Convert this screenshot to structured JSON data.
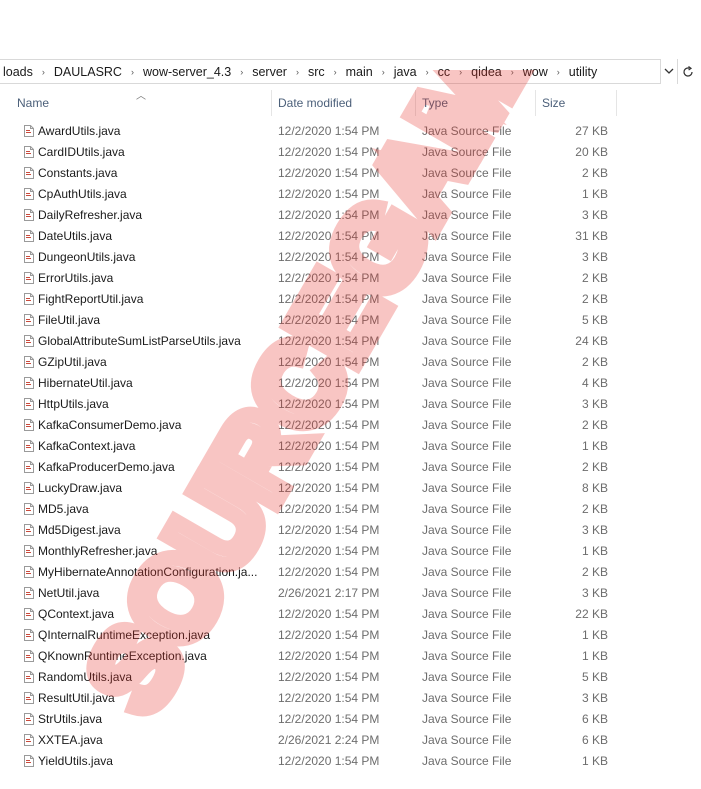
{
  "address_bar": {
    "crumbs": [
      "loads",
      "DAULASRC",
      "wow-server_4.3",
      "server",
      "src",
      "main",
      "java",
      "cc",
      "qidea",
      "wow",
      "utility"
    ]
  },
  "columns": {
    "name": "Name",
    "date": "Date modified",
    "type": "Type",
    "size": "Size"
  },
  "files": [
    {
      "name": "AwardUtils.java",
      "date": "12/2/2020 1:54 PM",
      "type": "Java Source File",
      "size": "27 KB"
    },
    {
      "name": "CardIDUtils.java",
      "date": "12/2/2020 1:54 PM",
      "type": "Java Source File",
      "size": "20 KB"
    },
    {
      "name": "Constants.java",
      "date": "12/2/2020 1:54 PM",
      "type": "Java Source File",
      "size": "2 KB"
    },
    {
      "name": "CpAuthUtils.java",
      "date": "12/2/2020 1:54 PM",
      "type": "Java Source File",
      "size": "1 KB"
    },
    {
      "name": "DailyRefresher.java",
      "date": "12/2/2020 1:54 PM",
      "type": "Java Source File",
      "size": "3 KB"
    },
    {
      "name": "DateUtils.java",
      "date": "12/2/2020 1:54 PM",
      "type": "Java Source File",
      "size": "31 KB"
    },
    {
      "name": "DungeonUtils.java",
      "date": "12/2/2020 1:54 PM",
      "type": "Java Source File",
      "size": "3 KB"
    },
    {
      "name": "ErrorUtils.java",
      "date": "12/2/2020 1:54 PM",
      "type": "Java Source File",
      "size": "2 KB"
    },
    {
      "name": "FightReportUtil.java",
      "date": "12/2/2020 1:54 PM",
      "type": "Java Source File",
      "size": "2 KB"
    },
    {
      "name": "FileUtil.java",
      "date": "12/2/2020 1:54 PM",
      "type": "Java Source File",
      "size": "5 KB"
    },
    {
      "name": "GlobalAttributeSumListParseUtils.java",
      "date": "12/2/2020 1:54 PM",
      "type": "Java Source File",
      "size": "24 KB"
    },
    {
      "name": "GZipUtil.java",
      "date": "12/2/2020 1:54 PM",
      "type": "Java Source File",
      "size": "2 KB"
    },
    {
      "name": "HibernateUtil.java",
      "date": "12/2/2020 1:54 PM",
      "type": "Java Source File",
      "size": "4 KB"
    },
    {
      "name": "HttpUtils.java",
      "date": "12/2/2020 1:54 PM",
      "type": "Java Source File",
      "size": "3 KB"
    },
    {
      "name": "KafkaConsumerDemo.java",
      "date": "12/2/2020 1:54 PM",
      "type": "Java Source File",
      "size": "2 KB"
    },
    {
      "name": "KafkaContext.java",
      "date": "12/2/2020 1:54 PM",
      "type": "Java Source File",
      "size": "1 KB"
    },
    {
      "name": "KafkaProducerDemo.java",
      "date": "12/2/2020 1:54 PM",
      "type": "Java Source File",
      "size": "2 KB"
    },
    {
      "name": "LuckyDraw.java",
      "date": "12/2/2020 1:54 PM",
      "type": "Java Source File",
      "size": "8 KB"
    },
    {
      "name": "MD5.java",
      "date": "12/2/2020 1:54 PM",
      "type": "Java Source File",
      "size": "2 KB"
    },
    {
      "name": "Md5Digest.java",
      "date": "12/2/2020 1:54 PM",
      "type": "Java Source File",
      "size": "3 KB"
    },
    {
      "name": "MonthlyRefresher.java",
      "date": "12/2/2020 1:54 PM",
      "type": "Java Source File",
      "size": "1 KB"
    },
    {
      "name": "MyHibernateAnnotationConfiguration.ja...",
      "date": "12/2/2020 1:54 PM",
      "type": "Java Source File",
      "size": "2 KB"
    },
    {
      "name": "NetUtil.java",
      "date": "2/26/2021 2:17 PM",
      "type": "Java Source File",
      "size": "3 KB"
    },
    {
      "name": "QContext.java",
      "date": "12/2/2020 1:54 PM",
      "type": "Java Source File",
      "size": "22 KB"
    },
    {
      "name": "QInternalRuntimeException.java",
      "date": "12/2/2020 1:54 PM",
      "type": "Java Source File",
      "size": "1 KB"
    },
    {
      "name": "QKnownRuntimeException.java",
      "date": "12/2/2020 1:54 PM",
      "type": "Java Source File",
      "size": "1 KB"
    },
    {
      "name": "RandomUtils.java",
      "date": "12/2/2020 1:54 PM",
      "type": "Java Source File",
      "size": "5 KB"
    },
    {
      "name": "ResultUtil.java",
      "date": "12/2/2020 1:54 PM",
      "type": "Java Source File",
      "size": "3 KB"
    },
    {
      "name": "StrUtils.java",
      "date": "12/2/2020 1:54 PM",
      "type": "Java Source File",
      "size": "6 KB"
    },
    {
      "name": "XXTEA.java",
      "date": "2/26/2021 2:24 PM",
      "type": "Java Source File",
      "size": "6 KB"
    },
    {
      "name": "YieldUtils.java",
      "date": "12/2/2020 1:54 PM",
      "type": "Java Source File",
      "size": "1 KB"
    }
  ],
  "watermark": {
    "text": "SOURCEGAME.NET",
    "color": "#e8332b"
  },
  "icons": {
    "file": "java-file-icon",
    "dropdown": "chevron-down-icon",
    "refresh": "refresh-icon",
    "sort": "sort-up-icon"
  }
}
